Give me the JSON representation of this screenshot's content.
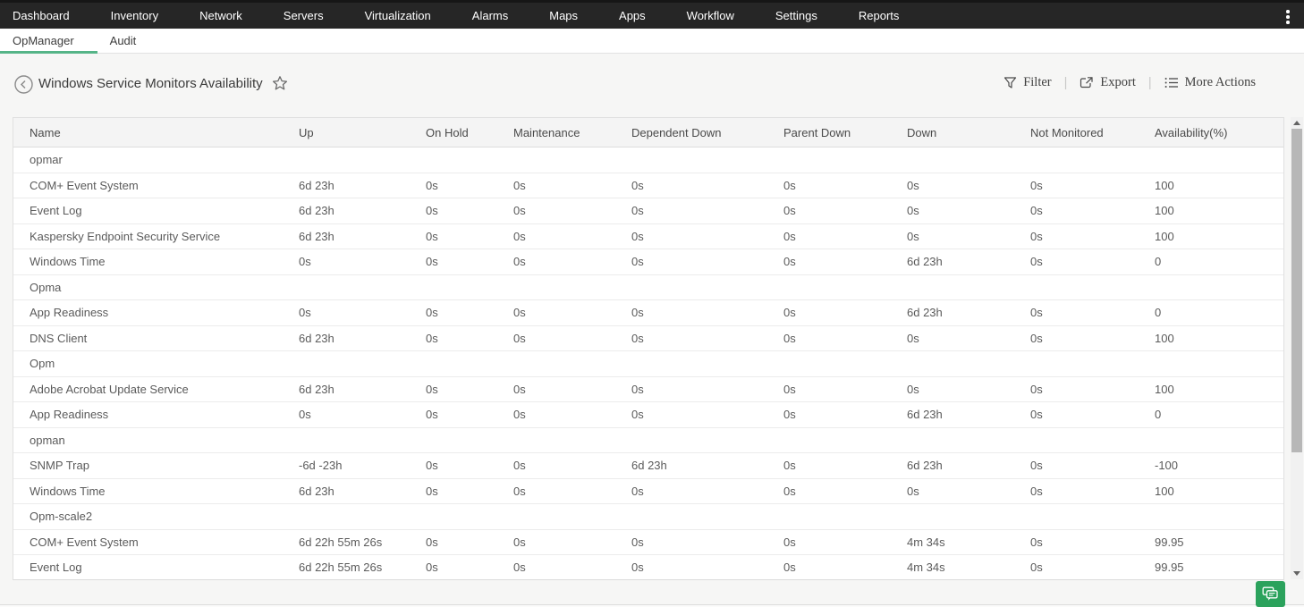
{
  "nav": {
    "items": [
      "Dashboard",
      "Inventory",
      "Network",
      "Servers",
      "Virtualization",
      "Alarms",
      "Maps",
      "Apps",
      "Workflow",
      "Settings",
      "Reports"
    ]
  },
  "tabs": [
    {
      "label": "OpManager",
      "active": true
    },
    {
      "label": "Audit",
      "active": false
    }
  ],
  "page": {
    "title": "Windows Service Monitors Availability",
    "actions": [
      {
        "label": "Filter",
        "icon": "filter-icon"
      },
      {
        "label": "Export",
        "icon": "export-icon"
      },
      {
        "label": "More Actions",
        "icon": "more-actions-icon"
      }
    ]
  },
  "colors": {
    "nav_bg": "#262626",
    "tab_accent": "#55b487",
    "chat_button": "#2ba25c"
  },
  "table": {
    "columns": [
      "Name",
      "Up",
      "On Hold",
      "Maintenance",
      "Dependent Down",
      "Parent Down",
      "Down",
      "Not Monitored",
      "Availability(%)"
    ],
    "rows": [
      {
        "type": "group",
        "label": "opmar"
      },
      {
        "type": "data",
        "cells": [
          "COM+ Event System",
          "6d 23h",
          "0s",
          "0s",
          "0s",
          "0s",
          "0s",
          "0s",
          "100"
        ]
      },
      {
        "type": "data",
        "cells": [
          "Event Log",
          "6d 23h",
          "0s",
          "0s",
          "0s",
          "0s",
          "0s",
          "0s",
          "100"
        ]
      },
      {
        "type": "data",
        "cells": [
          "Kaspersky Endpoint Security Service",
          "6d 23h",
          "0s",
          "0s",
          "0s",
          "0s",
          "0s",
          "0s",
          "100"
        ]
      },
      {
        "type": "data",
        "cells": [
          "Windows Time",
          "0s",
          "0s",
          "0s",
          "0s",
          "0s",
          "6d 23h",
          "0s",
          "0"
        ]
      },
      {
        "type": "group",
        "label": "Opma"
      },
      {
        "type": "data",
        "cells": [
          "App Readiness",
          "0s",
          "0s",
          "0s",
          "0s",
          "0s",
          "6d 23h",
          "0s",
          "0"
        ]
      },
      {
        "type": "data",
        "cells": [
          "DNS Client",
          "6d 23h",
          "0s",
          "0s",
          "0s",
          "0s",
          "0s",
          "0s",
          "100"
        ]
      },
      {
        "type": "group",
        "label": "Opm"
      },
      {
        "type": "data",
        "cells": [
          "Adobe Acrobat Update Service",
          "6d 23h",
          "0s",
          "0s",
          "0s",
          "0s",
          "0s",
          "0s",
          "100"
        ]
      },
      {
        "type": "data",
        "cells": [
          "App Readiness",
          "0s",
          "0s",
          "0s",
          "0s",
          "0s",
          "6d 23h",
          "0s",
          "0"
        ]
      },
      {
        "type": "group",
        "label": "opman"
      },
      {
        "type": "data",
        "cells": [
          "SNMP Trap",
          "-6d -23h",
          "0s",
          "0s",
          "6d 23h",
          "0s",
          "6d 23h",
          "0s",
          "-100"
        ]
      },
      {
        "type": "data",
        "cells": [
          "Windows Time",
          "6d 23h",
          "0s",
          "0s",
          "0s",
          "0s",
          "0s",
          "0s",
          "100"
        ]
      },
      {
        "type": "group",
        "label": "Opm-scale2"
      },
      {
        "type": "data",
        "cells": [
          "COM+ Event System",
          "6d 22h 55m 26s",
          "0s",
          "0s",
          "0s",
          "0s",
          "4m 34s",
          "0s",
          "99.95"
        ]
      },
      {
        "type": "data",
        "cells": [
          "Event Log",
          "6d 22h 55m 26s",
          "0s",
          "0s",
          "0s",
          "0s",
          "4m 34s",
          "0s",
          "99.95"
        ]
      }
    ]
  }
}
